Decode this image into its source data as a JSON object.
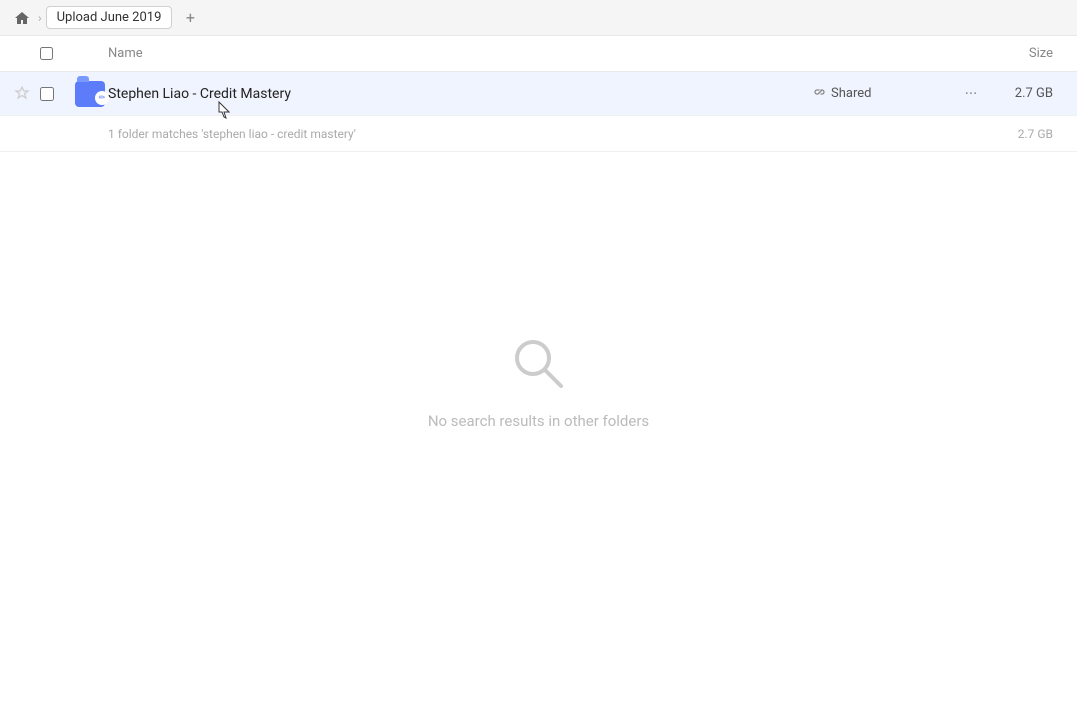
{
  "header": {
    "home_label": "Home",
    "breadcrumb_title": "Upload June 2019",
    "add_tab_label": "+"
  },
  "columns": {
    "name_label": "Name",
    "size_label": "Size"
  },
  "file_row": {
    "name": "Stephen Liao - Credit Mastery",
    "shared_label": "Shared",
    "size": "2.7 GB",
    "more_label": "···"
  },
  "match_row": {
    "text": "1 folder matches 'stephen liao - credit mastery'",
    "size": "2.7 GB"
  },
  "empty_state": {
    "message": "No search results in other folders"
  },
  "icons": {
    "home": "🏠",
    "chevron": "›",
    "star": "☆",
    "link": "🔗",
    "more": "···",
    "pen": "✏"
  }
}
